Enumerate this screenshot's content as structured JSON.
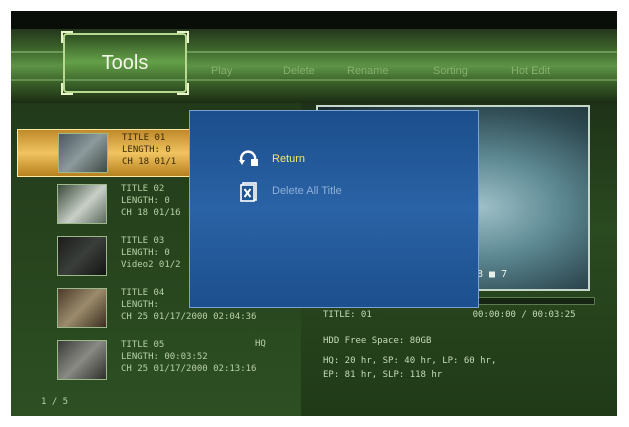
{
  "menu": {
    "tools_label": "Tools",
    "tabs": [
      "Play",
      "Delete",
      "Rename",
      "Sorting",
      "Hot Edit"
    ]
  },
  "titles": [
    {
      "line1": "TITLE 01",
      "line2": "LENGTH: 0",
      "line3": "CH 18 01/1",
      "quality": "",
      "selected": true
    },
    {
      "line1": "TITLE 02",
      "line2": "LENGTH: 0",
      "line3": "CH 18 01/16",
      "quality": "",
      "selected": false
    },
    {
      "line1": "TITLE 03",
      "line2": "LENGTH: 0",
      "line3": "Video2 01/2",
      "quality": "",
      "selected": false
    },
    {
      "line1": "TITLE 04",
      "line2": "LENGTH:",
      "line3": "CH 25 01/17/2000 02:04:36",
      "quality": "",
      "selected": false
    },
    {
      "line1": "TITLE 05",
      "line2": "LENGTH: 00:03:52",
      "line3": "CH 25 01/17/2000 02:13:16",
      "quality": "HQ",
      "selected": false
    }
  ],
  "page_indicator": "1 / 5",
  "preview": {
    "overlay_text": "8 ■ 7",
    "title_label": "TITLE: 01",
    "time": "00:00:00 / 00:03:25",
    "progress": 0.0
  },
  "info": {
    "free_space": "HDD Free Space: 80GB",
    "modes_line1": "HQ: 20 hr,    SP: 40 hr,    LP: 60 hr,",
    "modes_line2": "EP: 81 hr,    SLP: 118 hr"
  },
  "popup": {
    "return_label": "Return",
    "delete_all_label": "Delete All Title",
    "return_icon": "return-arrow-icon",
    "delete_icon": "delete-doc-icon"
  },
  "colors": {
    "menu_green": "#4f8539",
    "selected_row": "#f0c460",
    "popup_blue": "#2a63a6",
    "highlight_text": "#f5e86a"
  }
}
